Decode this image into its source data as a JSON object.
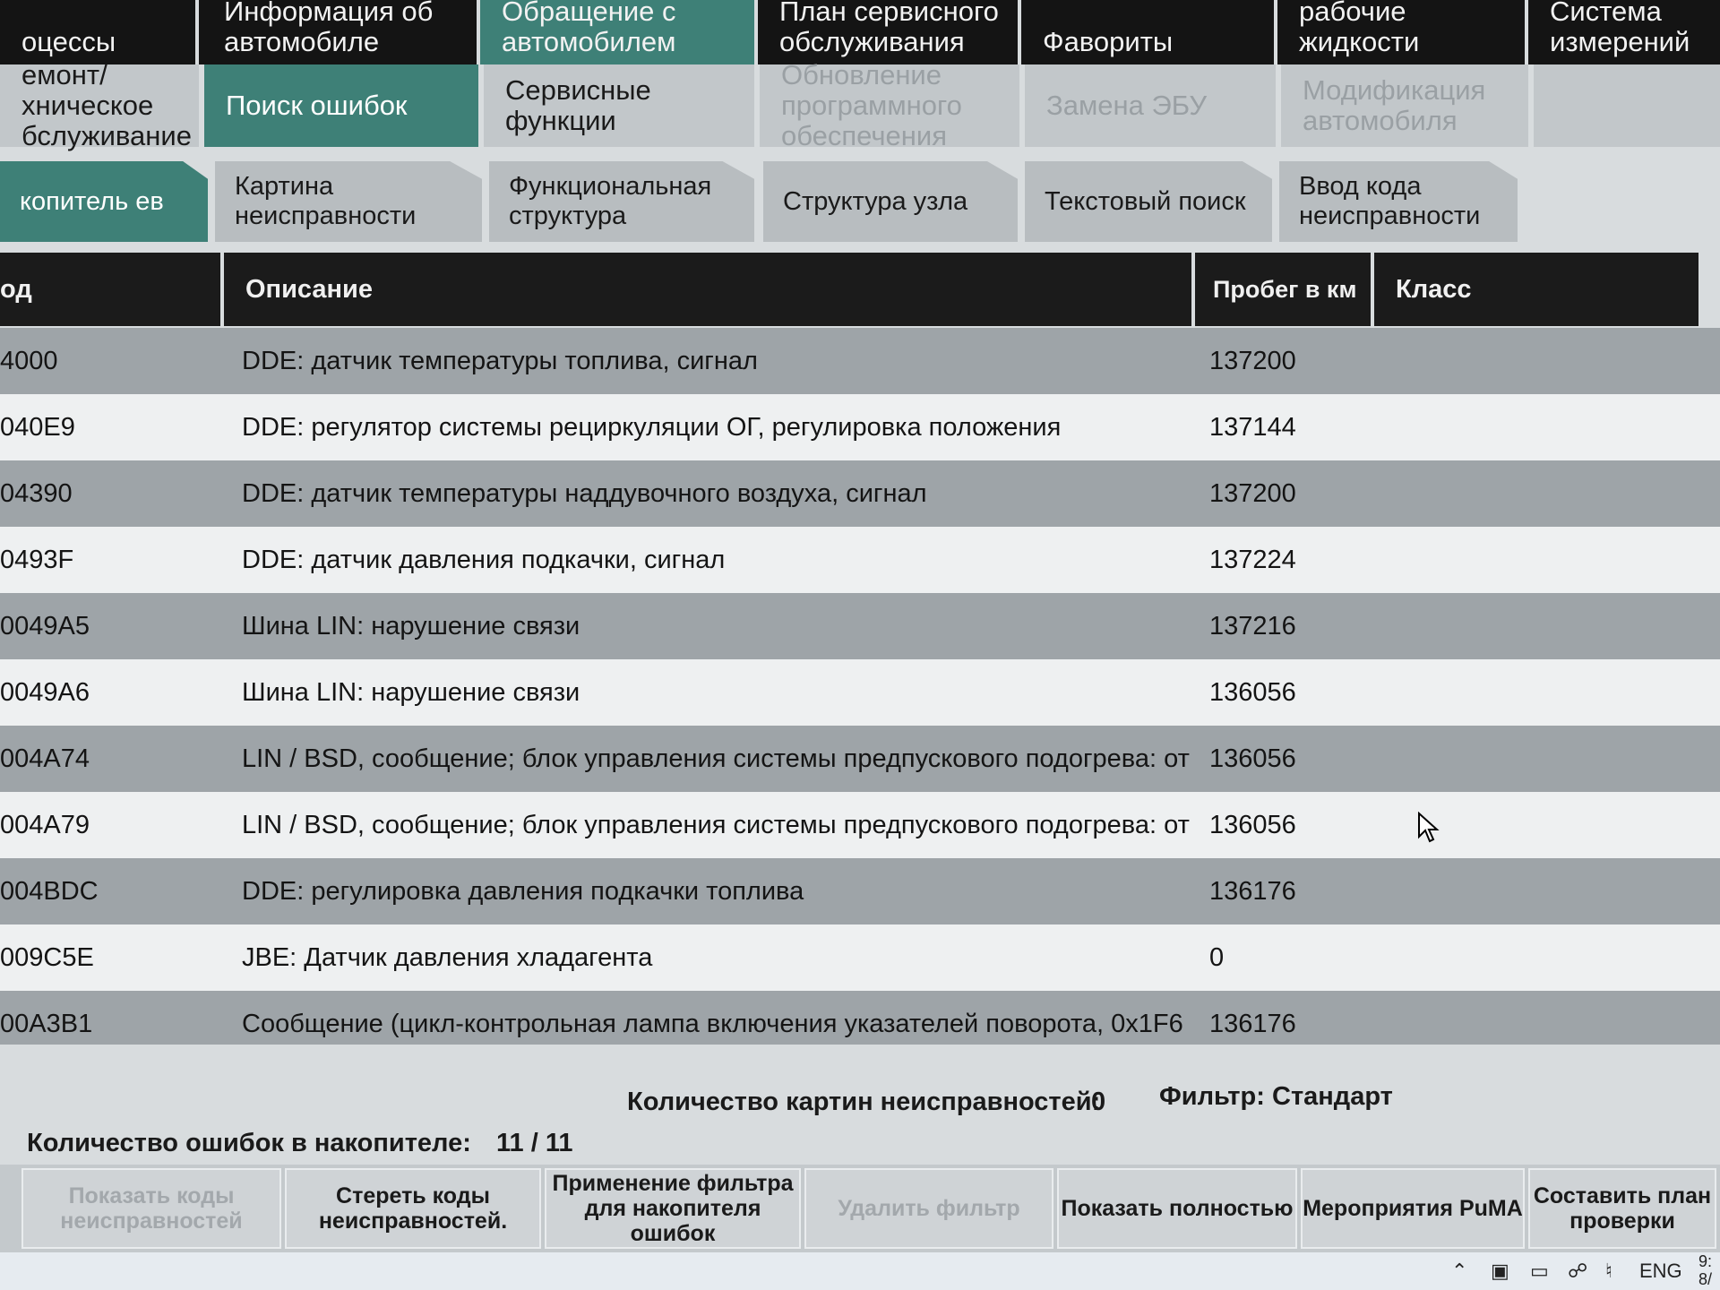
{
  "top_menu": [
    {
      "label": "оцессы"
    },
    {
      "label": "Информация об автомобиле"
    },
    {
      "label": "Обращение с автомобилем"
    },
    {
      "label": "План сервисного обслуживания"
    },
    {
      "label": "Фавориты"
    },
    {
      "label": "ремонтной зоны/ рабочие жидкости"
    },
    {
      "label": "Система измерений"
    }
  ],
  "sub_menu": [
    {
      "label": "емонт/ хническое бслуживание"
    },
    {
      "label": "Поиск ошибок"
    },
    {
      "label": "Сервисные функции"
    },
    {
      "label": "Обновление программного обеспечения"
    },
    {
      "label": "Замена ЭБУ"
    },
    {
      "label": "Модификация автомобиля"
    }
  ],
  "tool_tabs": [
    {
      "label": "копитель ев"
    },
    {
      "label": "Картина неисправности"
    },
    {
      "label": "Функциональная структура"
    },
    {
      "label": "Структура узла"
    },
    {
      "label": "Текстовый поиск"
    },
    {
      "label": "Ввод кода неисправности"
    }
  ],
  "table": {
    "headers": {
      "code": "од",
      "description": "Описание",
      "mileage": "Пробег в км",
      "class": "Класс"
    },
    "rows": [
      {
        "code": "4000",
        "description": "DDE: датчик температуры топлива, сигнал",
        "mileage": "137200"
      },
      {
        "code": "040E9",
        "description": "DDE: регулятор системы рециркуляции ОГ, регулировка положения",
        "mileage": "137144"
      },
      {
        "code": "04390",
        "description": "DDE: датчик температуры наддувочного воздуха, сигнал",
        "mileage": "137200"
      },
      {
        "code": "0493F",
        "description": "DDE: датчик давления подкачки, сигнал",
        "mileage": "137224"
      },
      {
        "code": "0049A5",
        "description": "Шина LIN: нарушение связи",
        "mileage": "137216"
      },
      {
        "code": "0049A6",
        "description": "Шина LIN: нарушение связи",
        "mileage": "136056"
      },
      {
        "code": "004A74",
        "description": "LIN / BSD, сообщение; блок управления системы предпускового подогрева: от",
        "mileage": "136056"
      },
      {
        "code": "004A79",
        "description": "LIN / BSD, сообщение; блок управления системы предпускового подогрева: от",
        "mileage": "136056"
      },
      {
        "code": "004BDC",
        "description": "DDE: регулировка давления подкачки топлива",
        "mileage": "136176"
      },
      {
        "code": "009C5E",
        "description": "JBE: Датчик давления хладагента",
        "mileage": "0"
      },
      {
        "code": "00A3B1",
        "description": "Сообщение (цикл-контрольная лампа включения указателей поворота, 0x1F6",
        "mileage": "136176"
      }
    ]
  },
  "footer": {
    "errors_label": "Количество ошибок в накопителе:",
    "errors_value": "11 / 11",
    "pictures_label": "Количество картин неисправностей:",
    "pictures_value": "0",
    "filter_label": "Фильтр:",
    "filter_value": "Стандарт"
  },
  "buttons": [
    {
      "label": "Показать коды неисправностей"
    },
    {
      "label": "Стереть коды неисправностей."
    },
    {
      "label": "Применение фильтра для накопителя ошибок"
    },
    {
      "label": "Удалить фильтр"
    },
    {
      "label": "Показать полностью"
    },
    {
      "label": "Мероприятия PuMA"
    },
    {
      "label": "Составить план проверки"
    }
  ],
  "taskbar": {
    "language": "ENG",
    "time": "9:",
    "date": "8/"
  },
  "colors": {
    "accent": "#3e8077",
    "header_bg": "#1b1b1b",
    "row_dark": "#9ea4a8",
    "row_light": "#eef0f1"
  }
}
